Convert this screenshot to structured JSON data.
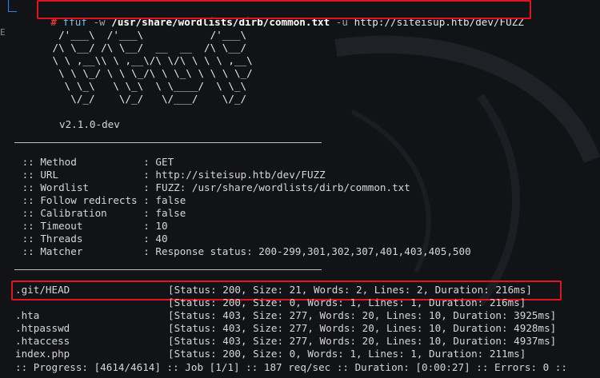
{
  "command": {
    "prompt_symbol": "#",
    "program": "ffuf",
    "flag_w": "-w",
    "wordlist_path": "/usr/share/wordlists/dirb/common.txt",
    "flag_u": "-u",
    "url": "http://siteisup.htb/dev/FUZZ"
  },
  "banner": {
    "art": [
      "       /'___\\  /'___\\           /'___\\",
      "      /\\ \\__/ /\\ \\__/  __  __  /\\ \\__/",
      "      \\ \\ ,__\\\\ \\ ,__\\/\\ \\/\\ \\ \\ \\ ,__\\",
      "       \\ \\ \\_/ \\ \\ \\_/\\ \\ \\_\\ \\ \\ \\ \\_/",
      "        \\ \\_\\   \\ \\_\\  \\ \\____/  \\ \\_\\",
      "         \\/_/    \\/_/   \\/___/    \\/_/"
    ],
    "version": "v2.1.0-dev"
  },
  "config": [
    {
      "key": " :: Method           ",
      "value": ": GET"
    },
    {
      "key": " :: URL              ",
      "value": ": http://siteisup.htb/dev/FUZZ"
    },
    {
      "key": " :: Wordlist         ",
      "value": ": FUZZ: /usr/share/wordlists/dirb/common.txt"
    },
    {
      "key": " :: Follow redirects ",
      "value": ": false"
    },
    {
      "key": " :: Calibration      ",
      "value": ": false"
    },
    {
      "key": " :: Timeout          ",
      "value": ": 10"
    },
    {
      "key": " :: Threads          ",
      "value": ": 40"
    },
    {
      "key": " :: Matcher          ",
      "value": ": Response status: 200-299,301,302,307,401,403,405,500"
    }
  ],
  "results": [
    {
      "path": ".git/HEAD",
      "info": "[Status: 200, Size: 21, Words: 2, Lines: 2, Duration: 216ms]"
    },
    {
      "path": "",
      "info": "[Status: 200, Size: 0, Words: 1, Lines: 1, Duration: 216ms]"
    },
    {
      "path": ".hta",
      "info": "[Status: 403, Size: 277, Words: 20, Lines: 10, Duration: 3925ms]"
    },
    {
      "path": ".htpasswd",
      "info": "[Status: 403, Size: 277, Words: 20, Lines: 10, Duration: 4928ms]"
    },
    {
      "path": ".htaccess",
      "info": "[Status: 403, Size: 277, Words: 20, Lines: 10, Duration: 4937ms]"
    },
    {
      "path": "index.php",
      "info": "[Status: 200, Size: 0, Words: 1, Lines: 1, Duration: 211ms]"
    }
  ],
  "progress": ":: Progress: [4614/4614] :: Job [1/1] :: 187 req/sec :: Duration: [0:00:27] :: Errors: 0 ::",
  "colors": {
    "background": "#121317",
    "highlight_box": "#e2141e",
    "prompt_hash": "#e03a3a",
    "program": "#6fc2f0"
  }
}
